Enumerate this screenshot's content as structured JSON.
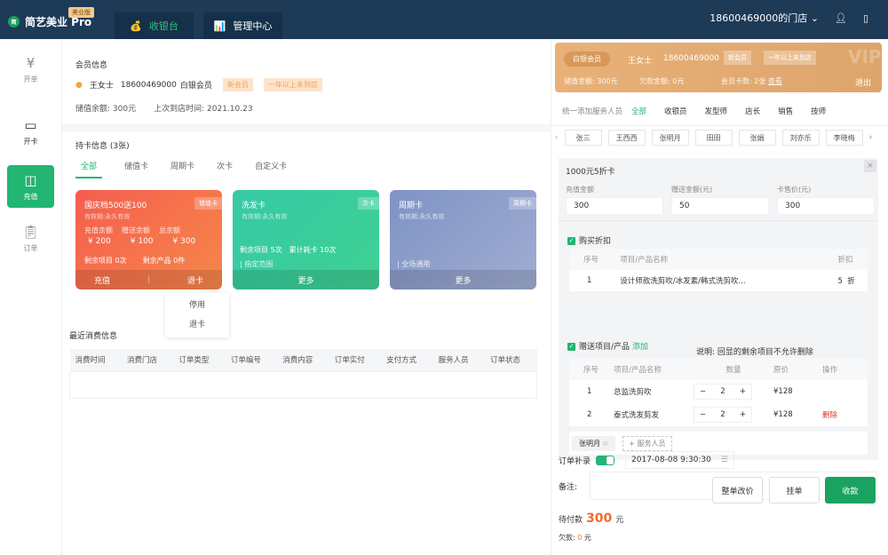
{
  "header": {
    "brand": "简艺美业 Pro",
    "edition": "美业版",
    "brand_badge": "简",
    "tabs": [
      {
        "label": "收银台",
        "icon": "money-bag-icon"
      },
      {
        "label": "管理中心",
        "icon": "chart-icon"
      }
    ],
    "store": "18600469000的门店"
  },
  "sidebar": {
    "items": [
      {
        "label": "开单",
        "icon": "yen-circle-icon"
      },
      {
        "label": "开卡",
        "icon": "card-icon"
      },
      {
        "label": "充值",
        "icon": "wallet-icon"
      },
      {
        "label": "订单",
        "icon": "clipboard-icon"
      }
    ]
  },
  "member": {
    "title": "会员信息",
    "name": "王女士",
    "phone": "18600469000",
    "level": "白银会员",
    "tags": [
      "新会员",
      "一年以上未到店"
    ],
    "balance_label": "储值余额:",
    "balance": "300元",
    "last_visit_label": "上次到店时间:",
    "last_visit": "2021.10.23"
  },
  "cards": {
    "title": "持卡信息",
    "count": "(3张)",
    "tabs": [
      "全部",
      "储值卡",
      "周期卡",
      "次卡",
      "自定义卡"
    ],
    "items": [
      {
        "name": "国庆档500送100",
        "type": "储值卡",
        "validity": "有效期:永久有效",
        "labels": [
          "充值余额",
          "赠送余额",
          "总余额"
        ],
        "values": [
          "¥ 200",
          "¥ 100",
          "¥ 300"
        ],
        "remain": "剩余项目 0次",
        "remain2": "剩余产品 0件",
        "actions": [
          "充值",
          "退卡"
        ]
      },
      {
        "name": "洗发卡",
        "type": "次卡",
        "validity": "有效期:永久有效",
        "remain": "剩余项目 5次",
        "remain2": "累计耗卡 10次",
        "scope": "指定范围",
        "actions": [
          "更多"
        ]
      },
      {
        "name": "周期卡",
        "type": "周期卡",
        "validity": "有效期:永久有效",
        "scope": "全场通用",
        "actions": [
          "更多"
        ]
      }
    ],
    "dropdown": [
      "停用",
      "退卡"
    ]
  },
  "recent": {
    "title": "最近消费信息",
    "columns": [
      "消费时间",
      "消费门店",
      "订单类型",
      "订单编号",
      "消费内容",
      "订单实付",
      "支付方式",
      "服务人员",
      "订单状态"
    ]
  },
  "vip": {
    "level": "白银会员",
    "name": "王女士",
    "phone": "18600469000",
    "tags": [
      "新会员",
      "一年以上未到店"
    ],
    "badge": "VIP",
    "stored_label": "储值金额:",
    "stored": "300元",
    "debt_label": "欠款金额:",
    "debt": "0元",
    "cards_label": "会员卡数:",
    "cards": "2张",
    "view": "查看",
    "logout": "退出"
  },
  "staff": {
    "label": "统一添加服务人员",
    "filters": [
      "全部",
      "收银员",
      "发型师",
      "店长",
      "销售",
      "技师"
    ],
    "people": [
      "张三",
      "王西西",
      "张明月",
      "田田",
      "张娟",
      "刘亦乐",
      "李晓梅"
    ]
  },
  "form": {
    "title": "1000元5折卡",
    "fields": [
      {
        "label": "充值金额",
        "value": "300"
      },
      {
        "label": "赠送金额(元)",
        "value": "50"
      },
      {
        "label": "卡售价(元)",
        "value": "300"
      }
    ],
    "discount": {
      "label": "购买折扣",
      "columns": [
        "序号",
        "项目/产品名称",
        "折扣"
      ],
      "rows": [
        {
          "no": "1",
          "name": "设计师款洗剪吹/冰发素/韩式洗剪吹...",
          "discount": "5",
          "unit": "折"
        }
      ]
    },
    "gift": {
      "label": "赠送项目/产品",
      "add": "添加",
      "note": "说明: 回显的剩余项目不允许删除",
      "columns": [
        "序号",
        "项目/产品名称",
        "数量",
        "原价",
        "操作"
      ],
      "rows": [
        {
          "no": "1",
          "name": "总监洗剪吹",
          "qty": "2",
          "price": "¥128",
          "op": ""
        },
        {
          "no": "2",
          "name": "泰式洗发剪发",
          "qty": "2",
          "price": "¥128",
          "op": "删除"
        }
      ]
    },
    "staff_chip": "张明月",
    "add_staff": "+ 服务人员"
  },
  "order": {
    "supplement_label": "订单补录",
    "supplement_on": true,
    "datetime": "2017-08-08 9:30:30",
    "remark_label": "备注:",
    "remark": "",
    "due_label": "待付款",
    "due": "300",
    "due_unit": "元",
    "owed_label": "欠款:",
    "owed": "0",
    "owed_unit": "元",
    "buttons": [
      "整单改价",
      "挂单",
      "收款"
    ]
  },
  "colors": {
    "header": "#1d3a57",
    "accent": "#22b573",
    "orange": "#f06b2e",
    "danger": "#e0301e"
  }
}
